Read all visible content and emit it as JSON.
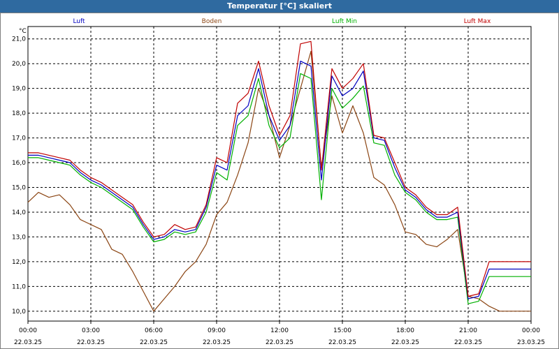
{
  "window": {
    "title": "Temperatur [°C] skaliert"
  },
  "chart_data": {
    "type": "line",
    "title": "Temperatur [°C] skaliert",
    "ylabel": "°C",
    "ylim": [
      9.6,
      21.5
    ],
    "xlim": [
      "22.03.25 00:00",
      "23.03.25 00:00"
    ],
    "grid": true,
    "legend": "top",
    "yticks": [
      "10,0",
      "11,0",
      "12,0",
      "13,0",
      "14,0",
      "15,0",
      "16,0",
      "17,0",
      "18,0",
      "19,0",
      "20,0",
      "21,0"
    ],
    "xticks": [
      {
        "time": "00:00",
        "date": "22.03.25"
      },
      {
        "time": "03:00",
        "date": "22.03.25"
      },
      {
        "time": "06:00",
        "date": "22.03.25"
      },
      {
        "time": "09:00",
        "date": "22.03.25"
      },
      {
        "time": "12:00",
        "date": "22.03.25"
      },
      {
        "time": "15:00",
        "date": "22.03.25"
      },
      {
        "time": "18:00",
        "date": "22.03.25"
      },
      {
        "time": "21:00",
        "date": "22.03.25"
      },
      {
        "time": "00:00",
        "date": "23.03.25"
      }
    ],
    "x": [
      0,
      0.5,
      1,
      1.5,
      2,
      2.5,
      3,
      3.5,
      4,
      4.5,
      5,
      5.5,
      6,
      6.5,
      7,
      7.5,
      8,
      8.5,
      9,
      9.5,
      10,
      10.5,
      11,
      11.5,
      12,
      12.5,
      13,
      13.5,
      14,
      14.5,
      15,
      15.5,
      16,
      16.5,
      17,
      17.5,
      18,
      18.5,
      19,
      19.5,
      20,
      20.5,
      21,
      21.5,
      22,
      22.5,
      23,
      23.5,
      24
    ],
    "series": [
      {
        "name": "Luft",
        "color": "#0000c0",
        "values": [
          16.3,
          16.3,
          16.2,
          16.1,
          16.0,
          15.6,
          15.3,
          15.1,
          14.8,
          14.5,
          14.2,
          13.5,
          12.9,
          13.0,
          13.3,
          13.2,
          13.3,
          14.2,
          15.9,
          15.7,
          17.9,
          18.3,
          19.8,
          17.9,
          16.9,
          17.5,
          20.1,
          19.9,
          15.3,
          19.5,
          18.7,
          19.0,
          19.7,
          17.0,
          16.9,
          15.8,
          14.9,
          14.6,
          14.1,
          13.8,
          13.8,
          14.0,
          10.5,
          10.6,
          11.7,
          11.7,
          11.7,
          11.7,
          11.7
        ]
      },
      {
        "name": "Boden",
        "color": "#8b4513",
        "values": [
          14.4,
          14.8,
          14.6,
          14.7,
          14.3,
          13.7,
          13.5,
          13.3,
          12.5,
          12.3,
          11.6,
          10.8,
          10.0,
          10.5,
          11.0,
          11.6,
          12.0,
          12.7,
          13.9,
          14.4,
          15.5,
          16.8,
          19.0,
          17.9,
          16.2,
          17.5,
          19.0,
          20.5,
          15.8,
          18.7,
          17.2,
          18.3,
          17.2,
          15.4,
          15.1,
          14.3,
          13.2,
          13.1,
          12.7,
          12.6,
          12.9,
          13.3,
          10.6,
          10.5,
          10.2,
          10.0,
          10.0,
          10.0,
          10.0
        ]
      },
      {
        "name": "Luft Min",
        "color": "#00b000",
        "values": [
          16.2,
          16.2,
          16.1,
          16.0,
          15.9,
          15.5,
          15.2,
          15.0,
          14.7,
          14.4,
          14.1,
          13.4,
          12.8,
          12.9,
          13.2,
          13.1,
          13.2,
          14.0,
          15.6,
          15.3,
          17.5,
          17.9,
          19.4,
          17.5,
          16.6,
          17.0,
          19.6,
          19.4,
          14.5,
          19.0,
          18.2,
          18.6,
          19.1,
          16.8,
          16.7,
          15.5,
          14.8,
          14.5,
          14.0,
          13.7,
          13.7,
          13.8,
          10.3,
          10.4,
          11.4,
          11.4,
          11.4,
          11.4,
          11.4
        ]
      },
      {
        "name": "Luft Max",
        "color": "#c00000",
        "values": [
          16.4,
          16.4,
          16.3,
          16.2,
          16.1,
          15.7,
          15.4,
          15.2,
          14.9,
          14.6,
          14.3,
          13.6,
          13.0,
          13.1,
          13.5,
          13.3,
          13.4,
          14.3,
          16.2,
          16.0,
          18.4,
          18.8,
          20.1,
          18.3,
          17.1,
          17.9,
          20.8,
          20.9,
          15.7,
          19.8,
          19.0,
          19.4,
          20.0,
          17.1,
          17.0,
          16.0,
          15.0,
          14.7,
          14.2,
          13.9,
          13.9,
          14.2,
          10.6,
          10.7,
          12.0,
          12.0,
          12.0,
          12.0,
          12.0
        ]
      }
    ]
  }
}
